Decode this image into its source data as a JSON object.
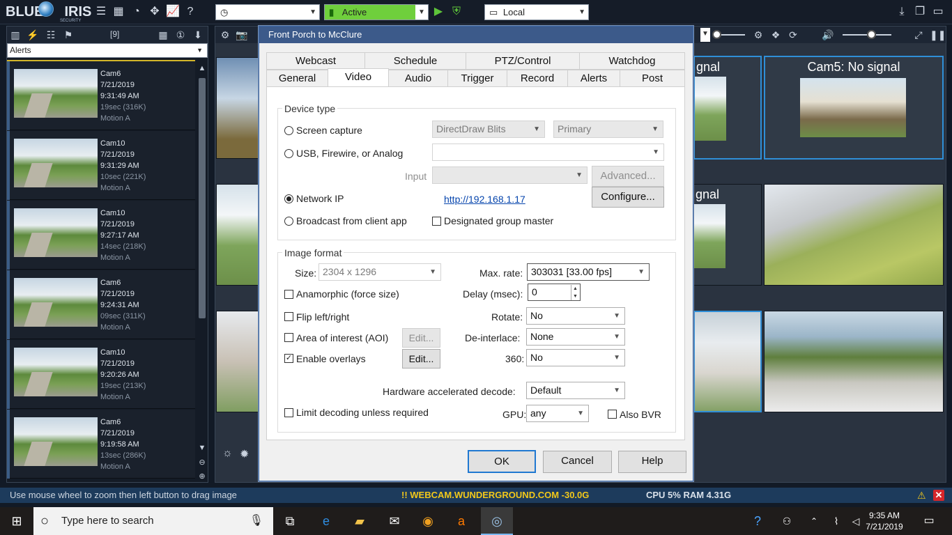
{
  "app": {
    "logo_blue": "BLUE",
    "logo_iris": "IRIS",
    "logo_sub": "SECURITY"
  },
  "toolbar": {
    "schedule_combo": "",
    "profile_combo": "Active",
    "server_combo": "Local",
    "colors": {
      "active": "#6fcf3c",
      "accent": "#2f8fd8"
    }
  },
  "left_panel": {
    "count": "[9]",
    "filter": "Alerts",
    "alerts": [
      {
        "cam": "Cam6",
        "date": "7/21/2019",
        "time": "9:31:49 AM",
        "size": "19sec (316K)",
        "type": "Motion A"
      },
      {
        "cam": "Cam10",
        "date": "7/21/2019",
        "time": "9:31:29 AM",
        "size": "10sec (221K)",
        "type": "Motion A"
      },
      {
        "cam": "Cam10",
        "date": "7/21/2019",
        "time": "9:27:17 AM",
        "size": "14sec (218K)",
        "type": "Motion A"
      },
      {
        "cam": "Cam6",
        "date": "7/21/2019",
        "time": "9:24:31 AM",
        "size": "09sec (311K)",
        "type": "Motion A"
      },
      {
        "cam": "Cam10",
        "date": "7/21/2019",
        "time": "9:20:26 AM",
        "size": "19sec (213K)",
        "type": "Motion A"
      },
      {
        "cam": "Cam6",
        "date": "7/21/2019",
        "time": "9:19:58 AM",
        "size": "13sec (286K)",
        "type": "Motion A"
      }
    ]
  },
  "cameras": {
    "cam5_title": "Cam5: No signal",
    "partial1": "gnal",
    "partial2": "gnal"
  },
  "dialog": {
    "title": "Front Porch to McClure",
    "tabs_row1": [
      "Webcast",
      "Schedule",
      "PTZ/Control",
      "Watchdog"
    ],
    "tabs_row2": [
      "General",
      "Video",
      "Audio",
      "Trigger",
      "Record",
      "Alerts",
      "Post"
    ],
    "device_type": {
      "label": "Device type",
      "screen_capture": "Screen capture",
      "screen_mode": "DirectDraw Blits",
      "screen_monitor": "Primary",
      "usb": "USB, Firewire, or Analog",
      "usb_device": "",
      "input_label": "Input",
      "input_value": "",
      "advanced": "Advanced...",
      "network_ip": "Network IP",
      "ip_link": "http://192.168.1.17",
      "configure": "Configure...",
      "broadcast": "Broadcast from client app",
      "group_master": "Designated group master"
    },
    "image_format": {
      "label": "Image format",
      "size_label": "Size:",
      "size_value": "2304 x 1296",
      "max_rate_label": "Max. rate:",
      "max_rate_value": "303031 [33.00 fps]",
      "anamorphic": "Anamorphic (force size)",
      "delay_label": "Delay (msec):",
      "delay_value": "0",
      "flip": "Flip left/right",
      "rotate_label": "Rotate:",
      "rotate_value": "No",
      "aoi": "Area of interest (AOI)",
      "aoi_edit": "Edit...",
      "deinterlace_label": "De-interlace:",
      "deinterlace_value": "None",
      "overlays": "Enable overlays",
      "overlays_edit": "Edit...",
      "v360_label": "360:",
      "v360_value": "No",
      "hw_label": "Hardware accelerated decode:",
      "hw_value": "Default",
      "limit": "Limit decoding unless required",
      "gpu_label": "GPU:",
      "gpu_value": "any",
      "bvr": "Also BVR"
    },
    "ok": "OK",
    "cancel": "Cancel",
    "help": "Help"
  },
  "statusbar": {
    "hint": "Use mouse wheel to zoom then left button to drag image",
    "weather": "!! WEBCAM.WUNDERGROUND.COM -30.0G",
    "cpu": "CPU 5% RAM 4.31G"
  },
  "taskbar": {
    "search": "Type here to search",
    "time": "9:35 AM",
    "date": "7/21/2019"
  }
}
